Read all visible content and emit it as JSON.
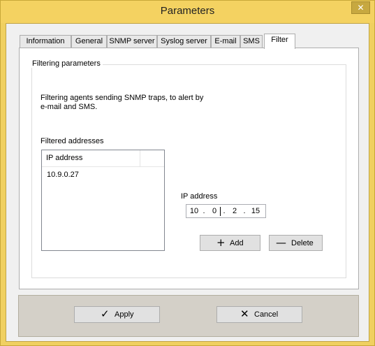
{
  "window": {
    "title": "Parameters",
    "close_glyph": "✕"
  },
  "tabs": [
    {
      "label": "Information",
      "active": false
    },
    {
      "label": "General",
      "active": false
    },
    {
      "label": "SNMP server",
      "active": false
    },
    {
      "label": "Syslog server",
      "active": false
    },
    {
      "label": "E-mail",
      "active": false
    },
    {
      "label": "SMS",
      "active": false
    },
    {
      "label": "Filter",
      "active": true
    }
  ],
  "filter": {
    "group_label": "Filtering parameters",
    "description": "Filtering agents sending SNMP traps, to alert by\ne-mail and SMS.",
    "list_label": "Filtered addresses",
    "list_column": "IP address",
    "list_items": [
      "10.9.0.27"
    ],
    "ip_label": "IP address",
    "ip_octets": [
      "10",
      "0",
      "2",
      "15"
    ],
    "ip_separator": ".",
    "add_button": {
      "label": "Add",
      "icon": "plus-icon",
      "glyph": "+"
    },
    "delete_button": {
      "label": "Delete",
      "icon": "minus-icon",
      "glyph": "—"
    }
  },
  "footer": {
    "apply_button": {
      "label": "Apply",
      "icon": "checkmark-icon",
      "glyph": "✓"
    },
    "cancel_button": {
      "label": "Cancel",
      "icon": "x-icon",
      "glyph": "✕"
    }
  }
}
